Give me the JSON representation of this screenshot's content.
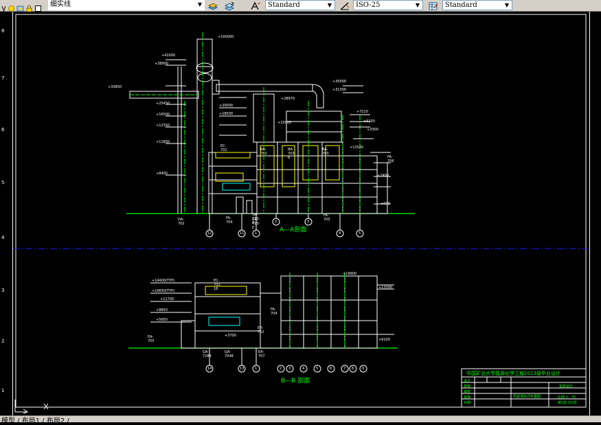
{
  "toolbar": {
    "linetype_value": "细实线",
    "text_style_value": "Standard",
    "dim_style_value": "ISO-25",
    "table_style_value": "Standard"
  },
  "ruler": {
    "left_ticks": [
      "8",
      "7",
      "6",
      "5",
      "4",
      "3",
      "2",
      "1"
    ]
  },
  "drawing": {
    "section_aa_title": "A—A剖面",
    "section_bb_title": "B—B 剖面",
    "title_block_header": "中国矿业大学能源化学工程2013级毕业设计",
    "title_block_design": "初步设计",
    "title_block_name": "乳胶漆车间布置图",
    "title_block_scale": "比例 1：75",
    "title_block_sheet": "第1张 共1张",
    "elev_top": "+100000",
    "elev_labels_aa": [
      "+41000",
      "+38900",
      "+33850",
      "+25450",
      "+16500",
      "+12350",
      "+11850",
      "+8400",
      "+35000",
      "+31300",
      "+28970",
      "+20000",
      "+18500",
      "+13520",
      "+7210",
      "+5200",
      "+3300",
      "+2400",
      "+000",
      "+15000"
    ],
    "elev_labels_bb": [
      "+14400(TYP)",
      "+10650(TYP)",
      "+11700",
      "+8850",
      "+5650",
      "+3700",
      "+19900",
      "+13300",
      "+6100"
    ],
    "equipment_aa": [
      "EC-702",
      "BA-702",
      "BA-703-B",
      "BA-703",
      "FA-706",
      "DA-702",
      "FA-704",
      "GA-715-B",
      "GA-715-E",
      "FA-705"
    ],
    "equipment_bb": [
      "EC-702-18",
      "FA-704",
      "EA-702",
      "EA-705",
      "GA-7288",
      "GA-7048",
      "EA-707"
    ],
    "axis_aa": [
      "12",
      "11",
      "1",
      "2",
      "3",
      "4",
      "5"
    ],
    "axis_bb": [
      "14",
      "13",
      "1",
      "2",
      "3",
      "4",
      "5",
      "6",
      "7",
      "8",
      "9"
    ],
    "title_block_rows": [
      "设计",
      "校核",
      "审核",
      "批准",
      "日期"
    ]
  },
  "status": {
    "tabs": "模型 / 布局1 / 布局2 /"
  },
  "colors": {
    "background": "#000000",
    "line_main": "#00ff00",
    "line_struct": "#ffffff",
    "line_equip": "#ffff00",
    "line_cut": "#0000ff",
    "line_pipe": "#00ffff"
  }
}
